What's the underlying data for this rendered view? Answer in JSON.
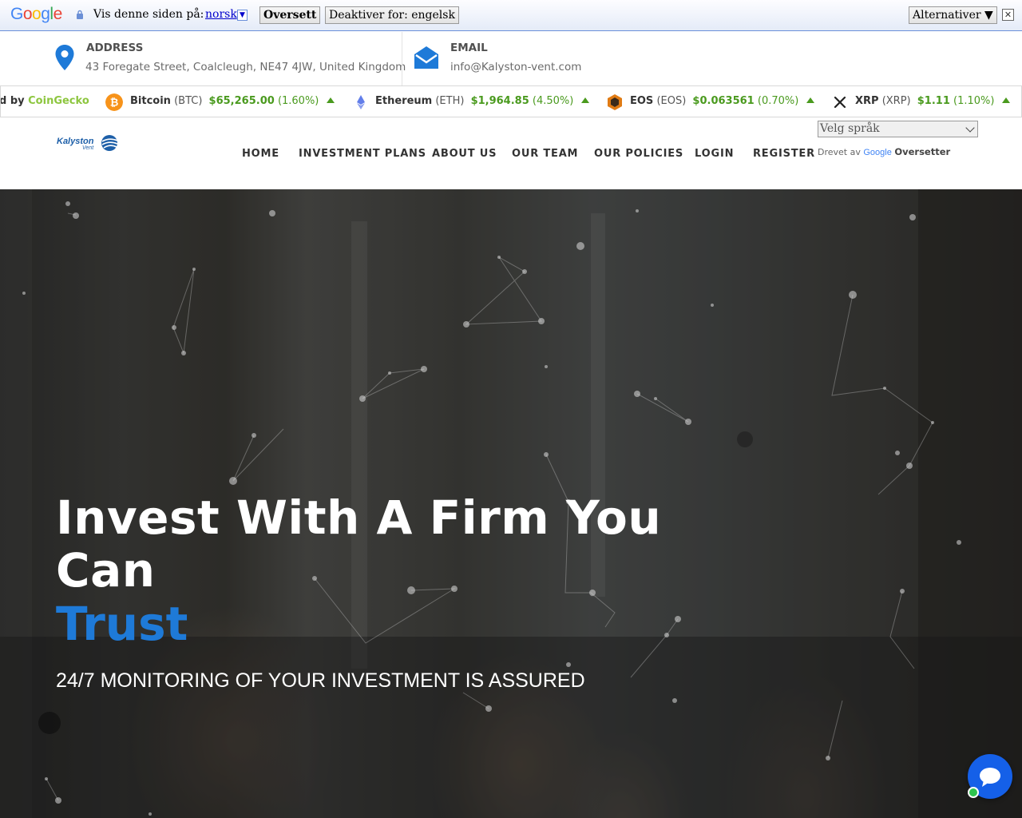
{
  "translate_bar": {
    "logo": "Google",
    "prompt": "Vis denne siden på:",
    "language": "norsk",
    "translate_button": "Oversett",
    "disable_button": "Deaktiver for: engelsk",
    "options_button": "Alternativer ▼",
    "close": "✕"
  },
  "contact": {
    "address_label": "ADDRESS",
    "address_value": "43 Foregate Street, Coalcleugh, NE47 4JW, United Kingdom",
    "email_label": "EMAIL",
    "email_value": "info@Kalyston-vent.com",
    "icons": [
      "map-pin-icon",
      "envelope-icon"
    ],
    "accent_color": "#1e7ad8"
  },
  "ticker": {
    "powered_prefix": "d by ",
    "powered_brand": "CoinGecko",
    "coins": [
      {
        "name": "Bitcoin",
        "symbol": "(BTC)",
        "price": "$65,265.00",
        "change": "(1.60%)",
        "icon": "bitcoin-icon"
      },
      {
        "name": "Ethereum",
        "symbol": "(ETH)",
        "price": "$1,964.85",
        "change": "(4.50%)",
        "icon": "ethereum-icon"
      },
      {
        "name": "EOS",
        "symbol": "(EOS)",
        "price": "$0.063561",
        "change": "(0.70%)",
        "icon": "eos-icon"
      },
      {
        "name": "XRP",
        "symbol": "(XRP)",
        "price": "$1.11",
        "change": "(1.10%)",
        "icon": "xrp-icon"
      }
    ],
    "up_color": "#4a9a1e"
  },
  "nav": {
    "logo_text": "Kalyston",
    "logo_sub": "Vent",
    "items": [
      "HOME",
      "INVESTMENT PLANS",
      "ABOUT US",
      "OUR TEAM",
      "OUR POLICIES",
      "LOGIN",
      "REGISTER"
    ],
    "language_select": "Velg språk",
    "powered_by": "Drevet av",
    "powered_google": "Google",
    "powered_service": "Oversetter"
  },
  "hero": {
    "title": "Invest With A Firm You Can",
    "accent": "Trust",
    "subtitle": "24/7 MONITORING OF YOUR INVESTMENT IS ASSURED"
  },
  "chat": {
    "icon": "chat-bubble-icon",
    "status_color": "#2ec44e"
  }
}
